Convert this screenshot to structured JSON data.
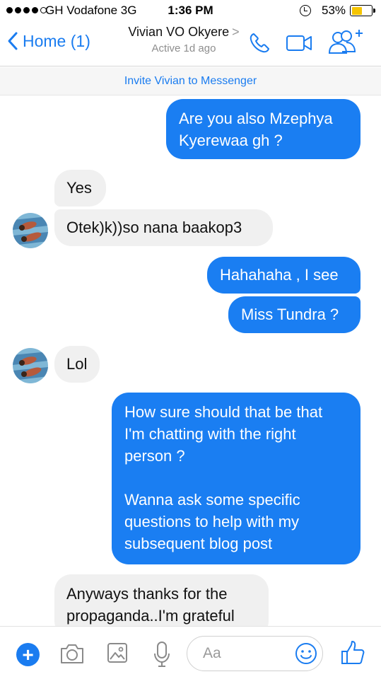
{
  "status_bar": {
    "carrier": "GH Vodafone  3G",
    "time": "1:36 PM",
    "battery": "53%",
    "battery_level": 0.53
  },
  "nav": {
    "back_label": "Home (1)",
    "contact_name": "Vivian VO Okyere",
    "contact_chevron": ">",
    "contact_status": "Active 1d ago"
  },
  "invite_text": "Invite Vivian to Messenger",
  "messages": [
    {
      "from": "me",
      "lines": [
        "Are you also Mzephya",
        "Kyerewaa gh ?"
      ]
    },
    {
      "from": "them",
      "lines": [
        "Yes"
      ]
    },
    {
      "from": "them",
      "lines": [
        "Otek)k))so nana baakop3"
      ]
    },
    {
      "from": "me",
      "lines": [
        "Hahahaha , I see"
      ]
    },
    {
      "from": "me",
      "lines": [
        "Miss Tundra ?"
      ]
    },
    {
      "from": "them",
      "lines": [
        "Lol"
      ]
    },
    {
      "from": "me",
      "lines": [
        "How sure should that be that",
        "I'm chatting with the right",
        "person ?",
        "",
        "Wanna ask some specific",
        "questions to help with my",
        "subsequent blog post"
      ]
    },
    {
      "from": "them",
      "lines": [
        "Anyways thanks for the",
        "propaganda..I'm grateful"
      ]
    }
  ],
  "composer": {
    "placeholder": "Aa",
    "icons": [
      "plus-icon",
      "camera-icon",
      "image-icon",
      "microphone-icon",
      "emoji-icon",
      "thumbs-up-icon"
    ]
  },
  "colors": {
    "accent": "#1a7cf0",
    "sent_bubble": "#1a7ef2",
    "received_bubble": "#f0f0f0",
    "battery": "#f5c400"
  }
}
